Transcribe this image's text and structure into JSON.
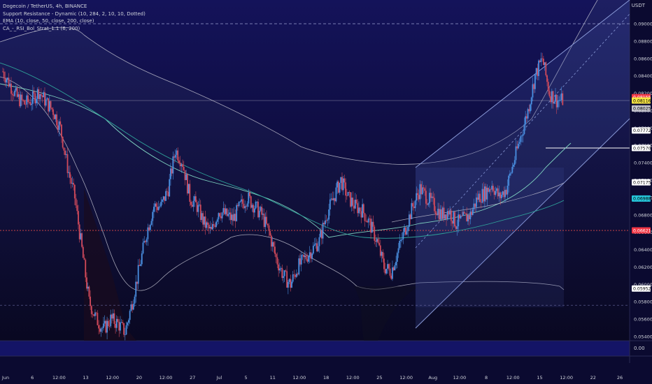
{
  "legend": {
    "title": "Dogecoin / TetherUS, 4h, BINANCE",
    "line2": "Support Resistance - Dynamic (10, 284, 2, 10, 10, Dotted)",
    "line3": "EMA (10, close, 50, close, 200, close)",
    "line4": "CA_-_RSI_Bol_Strat_1.1 (6, 200)"
  },
  "sub_pane_value": "0.00",
  "colors": {
    "background": "#0b0a30",
    "up": "#4a90e2",
    "down": "#d14a5b",
    "price_line": "#ffffff",
    "ema_fast": "#7fd3c0",
    "ema_slow": "#2fa39a",
    "band": "#c9c9d6",
    "support_line": "#e04a4a",
    "channel": "#8a9ad8"
  },
  "chart_data": {
    "type": "candlestick",
    "symbol": "Dogecoin / TetherUS",
    "interval": "4h",
    "exchange": "BINANCE",
    "currency": "USDT",
    "y_ticks": [
      "0.09000",
      "0.08800",
      "0.08600",
      "0.08400",
      "0.08200",
      "0.08000",
      "0.07800",
      "0.07600",
      "0.07400",
      "0.07200",
      "0.07000",
      "0.06800",
      "0.06600",
      "0.06400",
      "0.06200",
      "0.06000",
      "0.05800",
      "0.05600",
      "0.05400"
    ],
    "x_ticks": [
      "Jun",
      "6",
      "12:00",
      "13",
      "12:00",
      "20",
      "12:00",
      "27",
      "Jul",
      "5",
      "11",
      "12:00",
      "18",
      "12:00",
      "25",
      "12:00",
      "Aug",
      "12:00",
      "8",
      "12:00",
      "15",
      "12:00",
      "22",
      "26"
    ],
    "price_labels": [
      {
        "value": "0.08155",
        "bg": "#f23645",
        "fg": "#ffffff"
      },
      {
        "value": "0.08116",
        "bg": "#f6e443",
        "fg": "#000000"
      },
      {
        "value": "03:31:34",
        "bg": "#f6e443",
        "fg": "#000000"
      },
      {
        "value": "0.08025",
        "bg": "#c6c6cf",
        "fg": "#000000"
      },
      {
        "value": "0.07772",
        "bg": "#ffffff",
        "fg": "#000000"
      },
      {
        "value": "0.07570",
        "bg": "#ffffff",
        "fg": "#000000"
      },
      {
        "value": "0.07175",
        "bg": "#ffffff",
        "fg": "#000000"
      },
      {
        "value": "0.06988",
        "bg": "#26c6da",
        "fg": "#000000"
      },
      {
        "value": "0.06621",
        "bg": "#f23645",
        "fg": "#ffffff"
      },
      {
        "value": "0.05952",
        "bg": "#ffffff",
        "fg": "#000000"
      }
    ],
    "horizontal_levels": {
      "resistance_dashed": 0.09,
      "last_price": 0.08116,
      "support_red_dotted": 0.06621,
      "support_white": 0.0757,
      "low_dashed": 0.0576
    },
    "series": [
      {
        "type": "close_path",
        "x": [
          "06-01",
          "06-02",
          "06-03",
          "06-04",
          "06-05",
          "06-06",
          "06-07",
          "06-08",
          "06-09",
          "06-10",
          "06-11",
          "06-12",
          "06-13",
          "06-14",
          "06-15",
          "06-16",
          "06-17",
          "06-18",
          "06-19",
          "06-20",
          "06-21",
          "06-22",
          "06-23",
          "06-24",
          "06-25",
          "06-26",
          "06-27",
          "06-28",
          "06-29",
          "06-30",
          "07-01",
          "07-02",
          "07-03",
          "07-04",
          "07-05",
          "07-06",
          "07-07",
          "07-08",
          "07-09",
          "07-10",
          "07-11",
          "07-12",
          "07-13",
          "07-14",
          "07-15",
          "07-16",
          "07-17",
          "07-18",
          "07-19",
          "07-20",
          "07-21",
          "07-22",
          "07-23",
          "07-24",
          "07-25",
          "07-26",
          "07-27",
          "07-28",
          "07-29",
          "07-30",
          "07-31",
          "08-01",
          "08-02",
          "08-03",
          "08-04",
          "08-05",
          "08-06",
          "08-07",
          "08-08",
          "08-09",
          "08-10",
          "08-11",
          "08-12",
          "08-13",
          "08-14",
          "08-15",
          "08-16",
          "08-17",
          "08-18"
        ],
        "values": [
          0.0845,
          0.083,
          0.0815,
          0.0808,
          0.0812,
          0.0822,
          0.081,
          0.08,
          0.078,
          0.0735,
          0.07,
          0.064,
          0.058,
          0.056,
          0.0548,
          0.056,
          0.0555,
          0.0545,
          0.058,
          0.062,
          0.066,
          0.069,
          0.069,
          0.071,
          0.0755,
          0.074,
          0.07,
          0.069,
          0.067,
          0.066,
          0.0685,
          0.068,
          0.0675,
          0.069,
          0.07,
          0.069,
          0.068,
          0.066,
          0.063,
          0.061,
          0.06,
          0.062,
          0.063,
          0.064,
          0.065,
          0.068,
          0.07,
          0.072,
          0.07,
          0.069,
          0.0685,
          0.067,
          0.065,
          0.062,
          0.0615,
          0.064,
          0.0665,
          0.069,
          0.071,
          0.07,
          0.069,
          0.068,
          0.0685,
          0.067,
          0.0675,
          0.068,
          0.07,
          0.0705,
          0.0715,
          0.07,
          0.071,
          0.074,
          0.077,
          0.08,
          0.084,
          0.086,
          0.082,
          0.0812,
          0.0812
        ]
      }
    ]
  }
}
